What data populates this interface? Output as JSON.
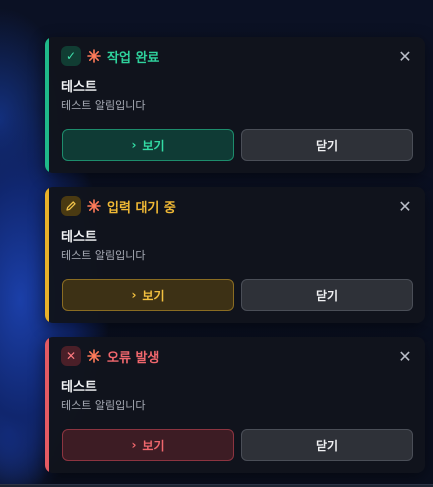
{
  "colors": {
    "success": "#1fb98a",
    "warning": "#e8b02a",
    "error": "#e45a63"
  },
  "toasts": [
    {
      "type": "success",
      "status_icon": "check-icon",
      "title": "작업 완료",
      "heading": "테스트",
      "body": "테스트 알림입니다",
      "view_label": "보기",
      "close_label": "닫기"
    },
    {
      "type": "warning",
      "status_icon": "pencil-icon",
      "title": "입력 대기 중",
      "heading": "테스트",
      "body": "테스트 알림입니다",
      "view_label": "보기",
      "close_label": "닫기"
    },
    {
      "type": "error",
      "status_icon": "x-icon",
      "title": "오류 발생",
      "heading": "테스트",
      "body": "테스트 알림입니다",
      "view_label": "보기",
      "close_label": "닫기"
    }
  ]
}
